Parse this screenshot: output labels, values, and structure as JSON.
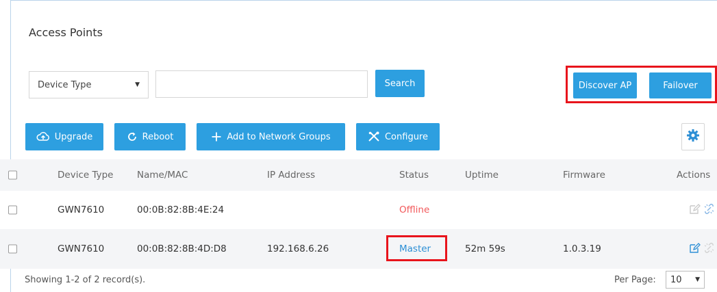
{
  "page": {
    "title": "Access Points"
  },
  "filter": {
    "device_type_select": "Device Type",
    "search_value": "",
    "search_button": "Search"
  },
  "top_actions": {
    "discover_ap": "Discover AP",
    "failover": "Failover"
  },
  "toolbar": {
    "upgrade": "Upgrade",
    "reboot": "Reboot",
    "add_to_groups": "Add to Network Groups",
    "configure": "Configure"
  },
  "table": {
    "headers": [
      "Device Type",
      "Name/MAC",
      "IP Address",
      "Status",
      "Uptime",
      "Firmware",
      "Actions"
    ],
    "rows": [
      {
        "device_type": "GWN7610",
        "mac": "00:0B:82:8B:4E:24",
        "ip": "",
        "status": "Offline",
        "uptime": "",
        "firmware": ""
      },
      {
        "device_type": "GWN7610",
        "mac": "00:0B:82:8B:4D:D8",
        "ip": "192.168.6.26",
        "status": "Master",
        "uptime": "52m 59s",
        "firmware": "1.0.3.19"
      }
    ]
  },
  "footer": {
    "records": "Showing 1-2 of 2 record(s).",
    "per_page_label": "Per Page:",
    "per_page_value": "10"
  },
  "colors": {
    "accent": "#2d9fe0",
    "highlight": "#e8141c",
    "offline": "#f2585a",
    "master": "#2d8fd5"
  }
}
